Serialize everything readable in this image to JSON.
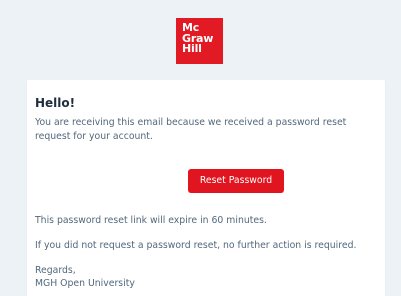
{
  "logo": {
    "line1": "Mc",
    "line2": "Graw",
    "line3": "Hill",
    "color": "#e21a23"
  },
  "email": {
    "greeting": "Hello!",
    "intro": "You are receiving this email because we received a password reset request for your account.",
    "button_label": "Reset Password",
    "expiry_note": "This password reset link will expire in 60 minutes.",
    "no_action_note": "If you did not request a password reset, no further action is required.",
    "regards": "Regards,",
    "sender": "MGH Open University"
  },
  "colors": {
    "background": "#edf2f7",
    "card": "#ffffff",
    "button": "#e0151f",
    "body_text": "#52687c",
    "heading_text": "#1f2d3d"
  }
}
